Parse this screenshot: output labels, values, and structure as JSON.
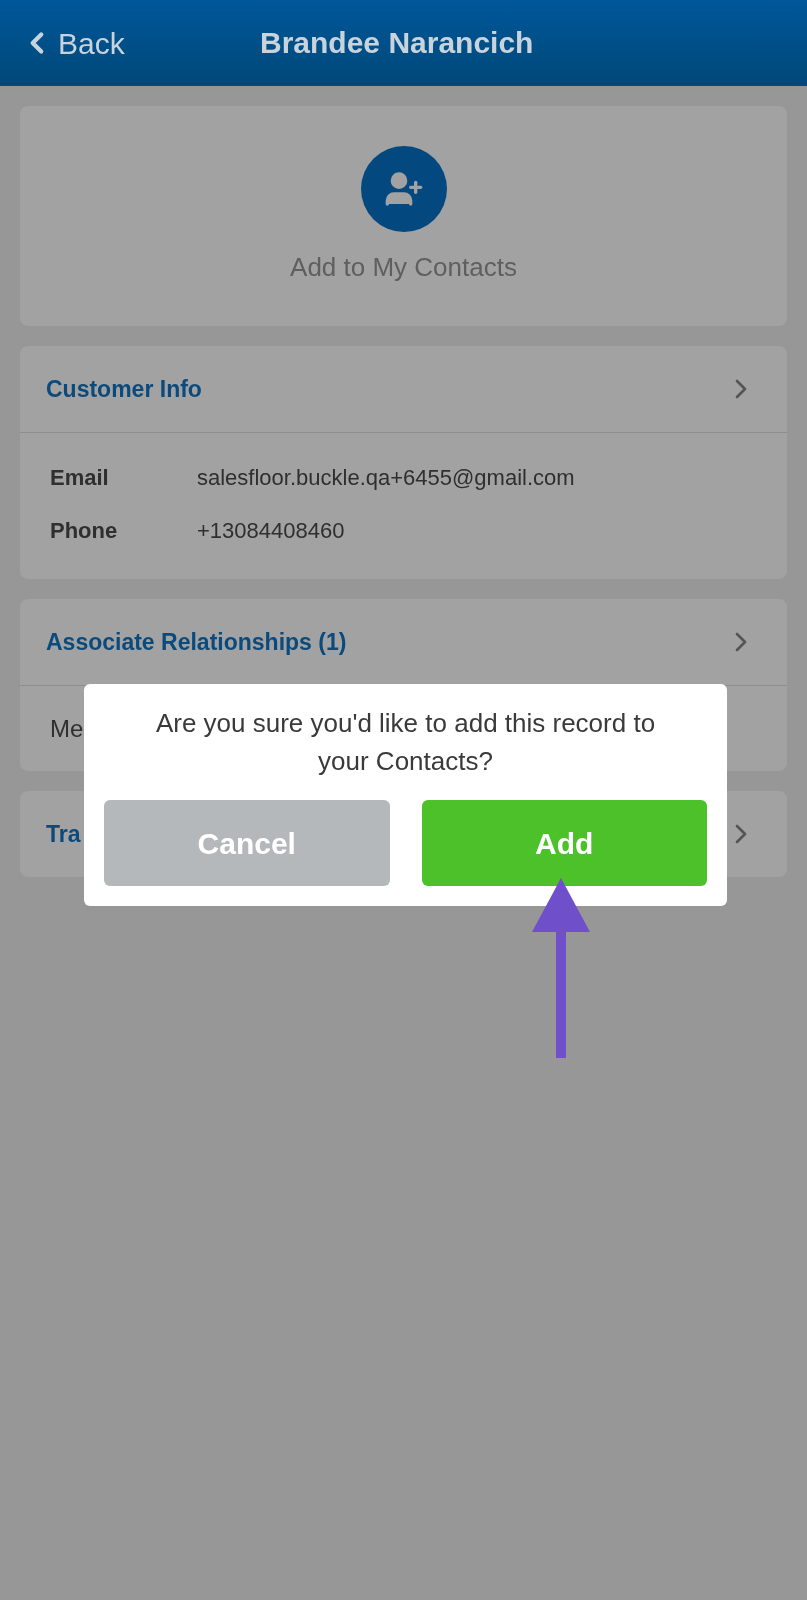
{
  "header": {
    "back": "Back",
    "title": "Brandee Narancich"
  },
  "add_contact": {
    "label": "Add to My Contacts"
  },
  "sections": [
    {
      "title": "Customer Info",
      "fields": [
        {
          "label": "Email",
          "value": "salesfloor.buckle.qa+6455@gmail.com"
        },
        {
          "label": "Phone",
          "value": "+13084408460"
        }
      ]
    },
    {
      "title": "Associate Relationships (1)",
      "body": "Me"
    },
    {
      "title": "Tra"
    }
  ],
  "dialog": {
    "message": "Are you sure you'd like to add this record to your Contacts?",
    "buttons": [
      {
        "label": "Cancel",
        "kind": "secondary"
      },
      {
        "label": "Add",
        "kind": "primary"
      }
    ]
  }
}
